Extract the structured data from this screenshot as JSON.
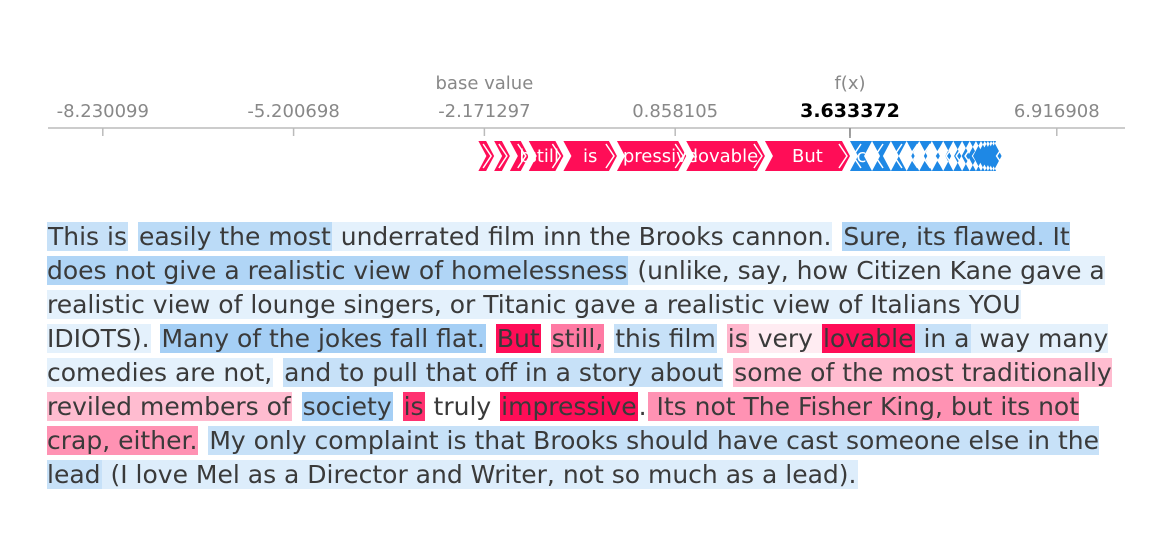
{
  "chart_data": {
    "type": "force_plot",
    "base_value_label": "base value",
    "base_value": -2.171297,
    "fx_label": "f(x)",
    "fx_value": 3.633372,
    "fx_value_text": "3.633372",
    "axis_ticks": [
      "-8.230099",
      "-5.200698",
      "-2.171297",
      "0.858105",
      "3.633372",
      "6.916908"
    ],
    "axis_tick_values": [
      -8.230099,
      -5.200698,
      -2.171297,
      0.858105,
      3.633372,
      6.916908
    ],
    "xlim": [
      -9.1,
      8.0
    ],
    "positive_color": "#ff0d57",
    "negative_color": "#1e88e5",
    "positive_features": [
      {
        "label": "",
        "value": 0.25
      },
      {
        "label": "",
        "value": 0.25
      },
      {
        "label": ", b",
        "value": 0.3
      },
      {
        "label": "still,",
        "value": 0.55
      },
      {
        "label": "is",
        "value": 0.85
      },
      {
        "label": "mpressive",
        "value": 1.1
      },
      {
        "label": "lovable",
        "value": 1.25
      },
      {
        "label": "But",
        "value": 1.35
      }
    ],
    "negative_features": [
      {
        "label": "ci",
        "value": 0.35
      },
      {
        "label": "",
        "value": 0.3
      },
      {
        "label": "",
        "value": 0.25
      },
      {
        "label": "",
        "value": 0.2
      },
      {
        "label": "",
        "value": 0.2
      },
      {
        "label": "",
        "value": 0.18
      },
      {
        "label": "",
        "value": 0.16
      },
      {
        "label": "",
        "value": 0.14
      },
      {
        "label": "",
        "value": 0.12
      },
      {
        "label": "",
        "value": 0.1
      },
      {
        "label": "",
        "value": 0.08
      },
      {
        "label": "",
        "value": 0.06
      },
      {
        "label": "",
        "value": 0.05
      },
      {
        "label": "",
        "value": 0.05
      },
      {
        "label": "",
        "value": 0.04
      },
      {
        "label": "",
        "value": 0.04
      }
    ]
  },
  "tokens": [
    {
      "t": "This is",
      "c": "neg",
      "s": 0.25
    },
    {
      "t": " ",
      "c": "none",
      "s": 0
    },
    {
      "t": "easily the most",
      "c": "neg",
      "s": 0.3
    },
    {
      "t": " underrated film inn the Brooks cannon.",
      "c": "neg",
      "s": 0.12
    },
    {
      "t": " ",
      "c": "none",
      "s": 0
    },
    {
      "t": "Sure, its flawed. It does not give a realistic view of homelessness",
      "c": "neg",
      "s": 0.35
    },
    {
      "t": " (unlike, say, how Citizen Kane gave a realistic view of lounge singers, or Titanic gave a realistic view of Italians YOU IDIOTS).",
      "c": "neg",
      "s": 0.12
    },
    {
      "t": " ",
      "c": "none",
      "s": 0
    },
    {
      "t": "Many of the jokes fall flat.",
      "c": "neg",
      "s": 0.4
    },
    {
      "t": " ",
      "c": "none",
      "s": 0
    },
    {
      "t": "But",
      "c": "pos",
      "s": 1.0
    },
    {
      "t": " ",
      "c": "none",
      "s": 0
    },
    {
      "t": "still,",
      "c": "pos",
      "s": 0.55
    },
    {
      "t": " ",
      "c": "none",
      "s": 0
    },
    {
      "t": "this film",
      "c": "neg",
      "s": 0.25
    },
    {
      "t": " ",
      "c": "none",
      "s": 0
    },
    {
      "t": "is",
      "c": "pos",
      "s": 0.3
    },
    {
      "t": " very ",
      "c": "pos",
      "s": 0.08
    },
    {
      "t": "lovable",
      "c": "pos",
      "s": 1.0
    },
    {
      "t": " in a",
      "c": "neg",
      "s": 0.25
    },
    {
      "t": " way many comedies are not,",
      "c": "neg",
      "s": 0.12
    },
    {
      "t": " ",
      "c": "none",
      "s": 0
    },
    {
      "t": "and to pull that off in a story about",
      "c": "neg",
      "s": 0.25
    },
    {
      "t": " ",
      "c": "none",
      "s": 0
    },
    {
      "t": "some of the most traditionally reviled members of",
      "c": "pos",
      "s": 0.28
    },
    {
      "t": " ",
      "c": "none",
      "s": 0
    },
    {
      "t": "society",
      "c": "neg",
      "s": 0.4
    },
    {
      "t": " ",
      "c": "none",
      "s": 0
    },
    {
      "t": "is",
      "c": "pos",
      "s": 0.85
    },
    {
      "t": " truly ",
      "c": "none",
      "s": 0
    },
    {
      "t": "impressive",
      "c": "pos",
      "s": 1.0
    },
    {
      "t": ".",
      "c": "none",
      "s": 0
    },
    {
      "t": " Its not The Fisher King, but its not crap, either.",
      "c": "pos",
      "s": 0.45
    },
    {
      "t": " ",
      "c": "none",
      "s": 0
    },
    {
      "t": "My only complaint is that Brooks should have cast someone else in the lead",
      "c": "neg",
      "s": 0.25
    },
    {
      "t": " (I love Mel as a Director and Writer, not so much as a lead).",
      "c": "neg",
      "s": 0.15
    }
  ]
}
